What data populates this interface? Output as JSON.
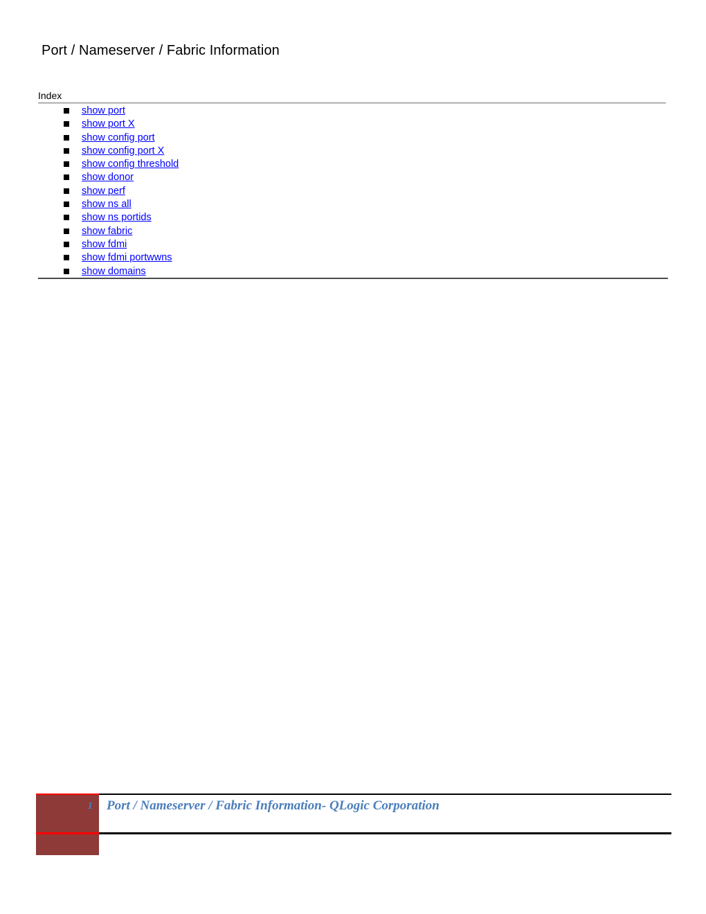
{
  "document": {
    "title": "Port / Nameserver / Fabric Information"
  },
  "index": {
    "label": "Index",
    "items": [
      {
        "label": "show port"
      },
      {
        "label": "show port X"
      },
      {
        "label": "show config port"
      },
      {
        "label": "show config port X"
      },
      {
        "label": "show config threshold"
      },
      {
        "label": "show donor"
      },
      {
        "label": "show perf"
      },
      {
        "label": "show ns all"
      },
      {
        "label": "show ns portids"
      },
      {
        "label": "show fabric"
      },
      {
        "label": "show fdmi"
      },
      {
        "label": "show fdmi portwwns"
      },
      {
        "label": "show domains"
      }
    ]
  },
  "footer": {
    "page_number": "1",
    "caption": "Port / Nameserver / Fabric Information- QLogic Corporation"
  },
  "colors": {
    "link": "#0000FF",
    "footer_text": "#4A7EBB",
    "footer_box": "#8E3A38",
    "footer_accent": "#FF0000",
    "rule": "#4A4A4A"
  }
}
